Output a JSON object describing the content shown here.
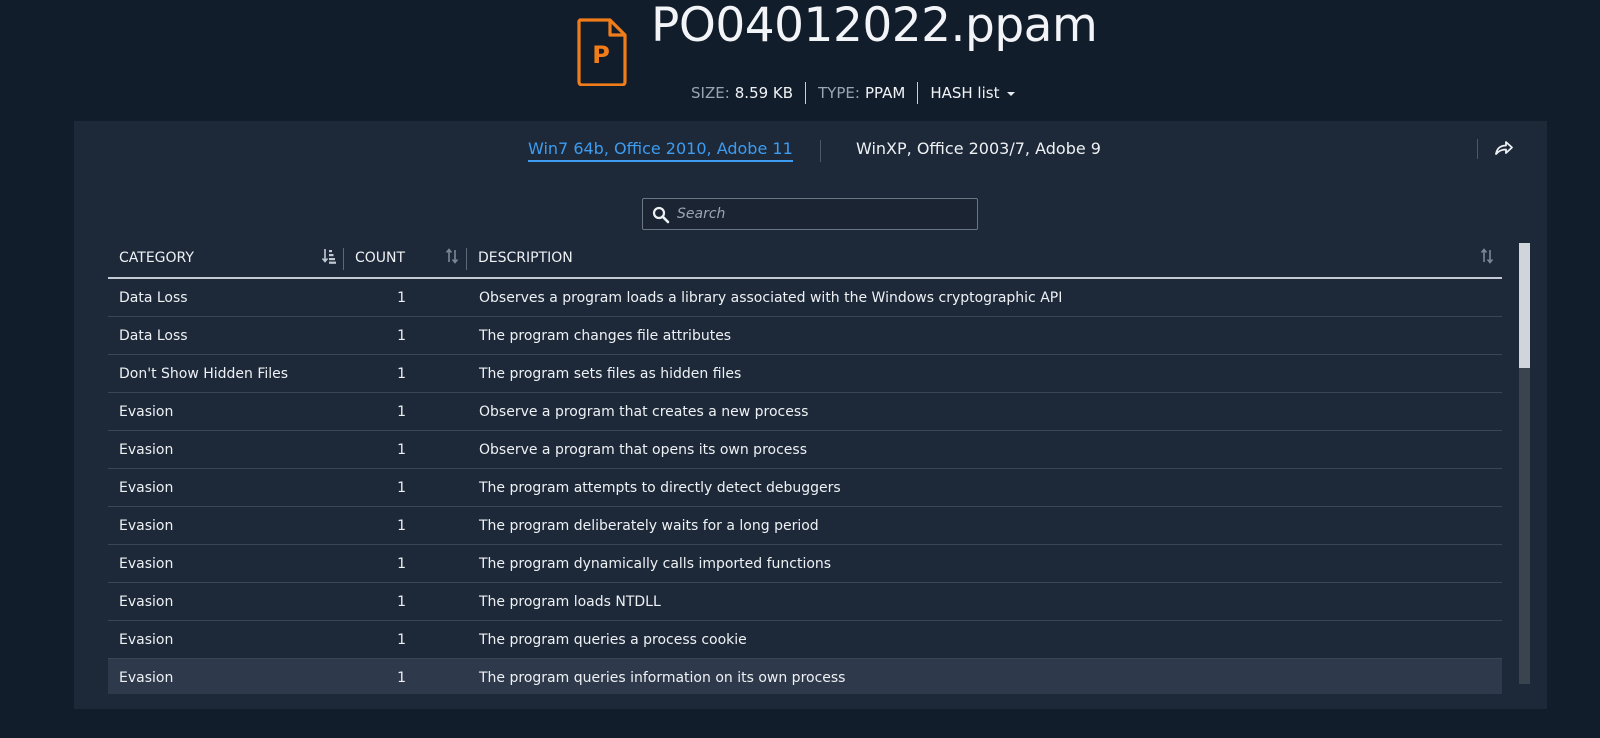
{
  "file": {
    "icon": "ppam-file-icon",
    "icon_letter": "P",
    "name": "PO04012022.ppam",
    "size_label": "SIZE:",
    "size_value": "8.59 KB",
    "type_label": "TYPE:",
    "type_value": "PPAM",
    "hash_label": "HASH list"
  },
  "environments": {
    "active": "Win7 64b, Office 2010, Adobe 11",
    "other": "WinXP, Office 2003/7, Adobe 9"
  },
  "search": {
    "placeholder": "Search"
  },
  "table": {
    "columns": [
      "CATEGORY",
      "COUNT",
      "DESCRIPTION"
    ],
    "rows": [
      {
        "category": "Data Loss",
        "count": "1",
        "description": "Observes a program loads a library associated with the Windows cryptographic API"
      },
      {
        "category": "Data Loss",
        "count": "1",
        "description": "The program changes file attributes"
      },
      {
        "category": "Don't Show Hidden Files",
        "count": "1",
        "description": "The program sets files as hidden files"
      },
      {
        "category": "Evasion",
        "count": "1",
        "description": "Observe a program that creates a new process"
      },
      {
        "category": "Evasion",
        "count": "1",
        "description": "Observe a program that opens its own process"
      },
      {
        "category": "Evasion",
        "count": "1",
        "description": "The program attempts to directly detect debuggers"
      },
      {
        "category": "Evasion",
        "count": "1",
        "description": "The program deliberately waits for a long period"
      },
      {
        "category": "Evasion",
        "count": "1",
        "description": "The program dynamically calls imported functions"
      },
      {
        "category": "Evasion",
        "count": "1",
        "description": "The program loads NTDLL"
      },
      {
        "category": "Evasion",
        "count": "1",
        "description": "The program queries a process cookie"
      },
      {
        "category": "Evasion",
        "count": "1",
        "description": "The program queries information on its own process"
      }
    ]
  },
  "colors": {
    "background": "#121d2b",
    "panel": "#1d2939",
    "accent": "#3d9cf0",
    "icon_orange": "#f07d1a"
  }
}
